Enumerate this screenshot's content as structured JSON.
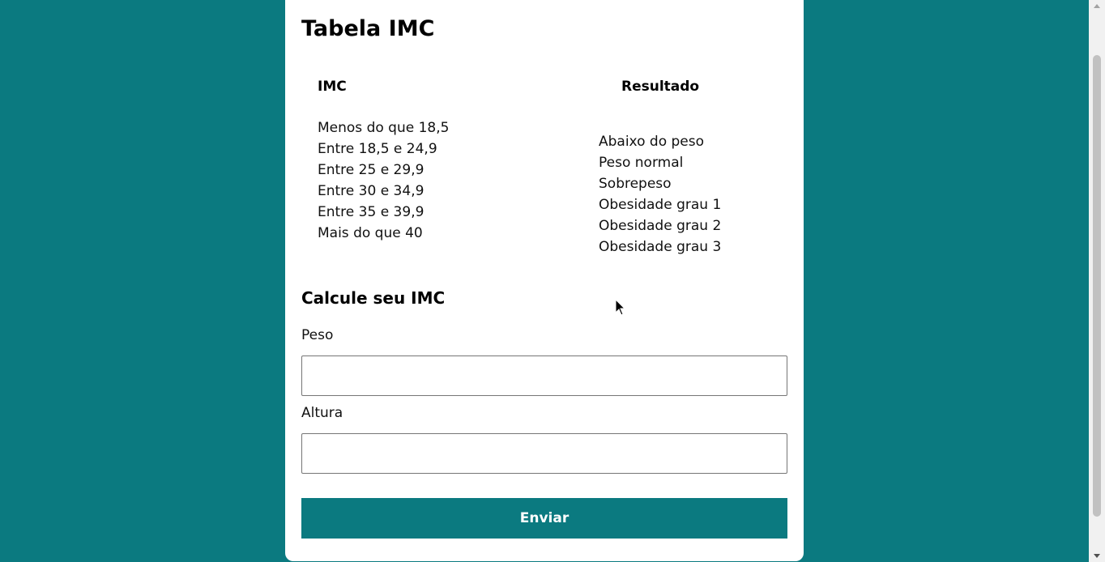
{
  "page": {
    "title": "Tabela IMC",
    "table": {
      "header_imc": "IMC",
      "header_result": "Resultado",
      "imc_ranges": [
        "Menos do que 18,5",
        "Entre 18,5 e 24,9",
        "Entre 25 e 29,9",
        "Entre 30 e 34,9",
        "Entre 35 e 39,9",
        "Mais do que 40"
      ],
      "results": [
        "Abaixo do peso",
        "Peso normal",
        "Sobrepeso",
        "Obesidade grau 1",
        "Obesidade grau 2",
        "Obesidade grau 3"
      ]
    },
    "form": {
      "title": "Calcule seu IMC",
      "peso_label": "Peso",
      "peso_value": "",
      "altura_label": "Altura",
      "altura_value": "",
      "submit_label": "Enviar"
    }
  },
  "colors": {
    "background": "#0b7a80",
    "card": "#ffffff",
    "button": "#0b7a80"
  },
  "icons": {
    "cursor": "mouse-pointer-icon",
    "scroll_up": "scroll-up-arrow-icon",
    "scroll_down": "scroll-down-arrow-icon"
  }
}
